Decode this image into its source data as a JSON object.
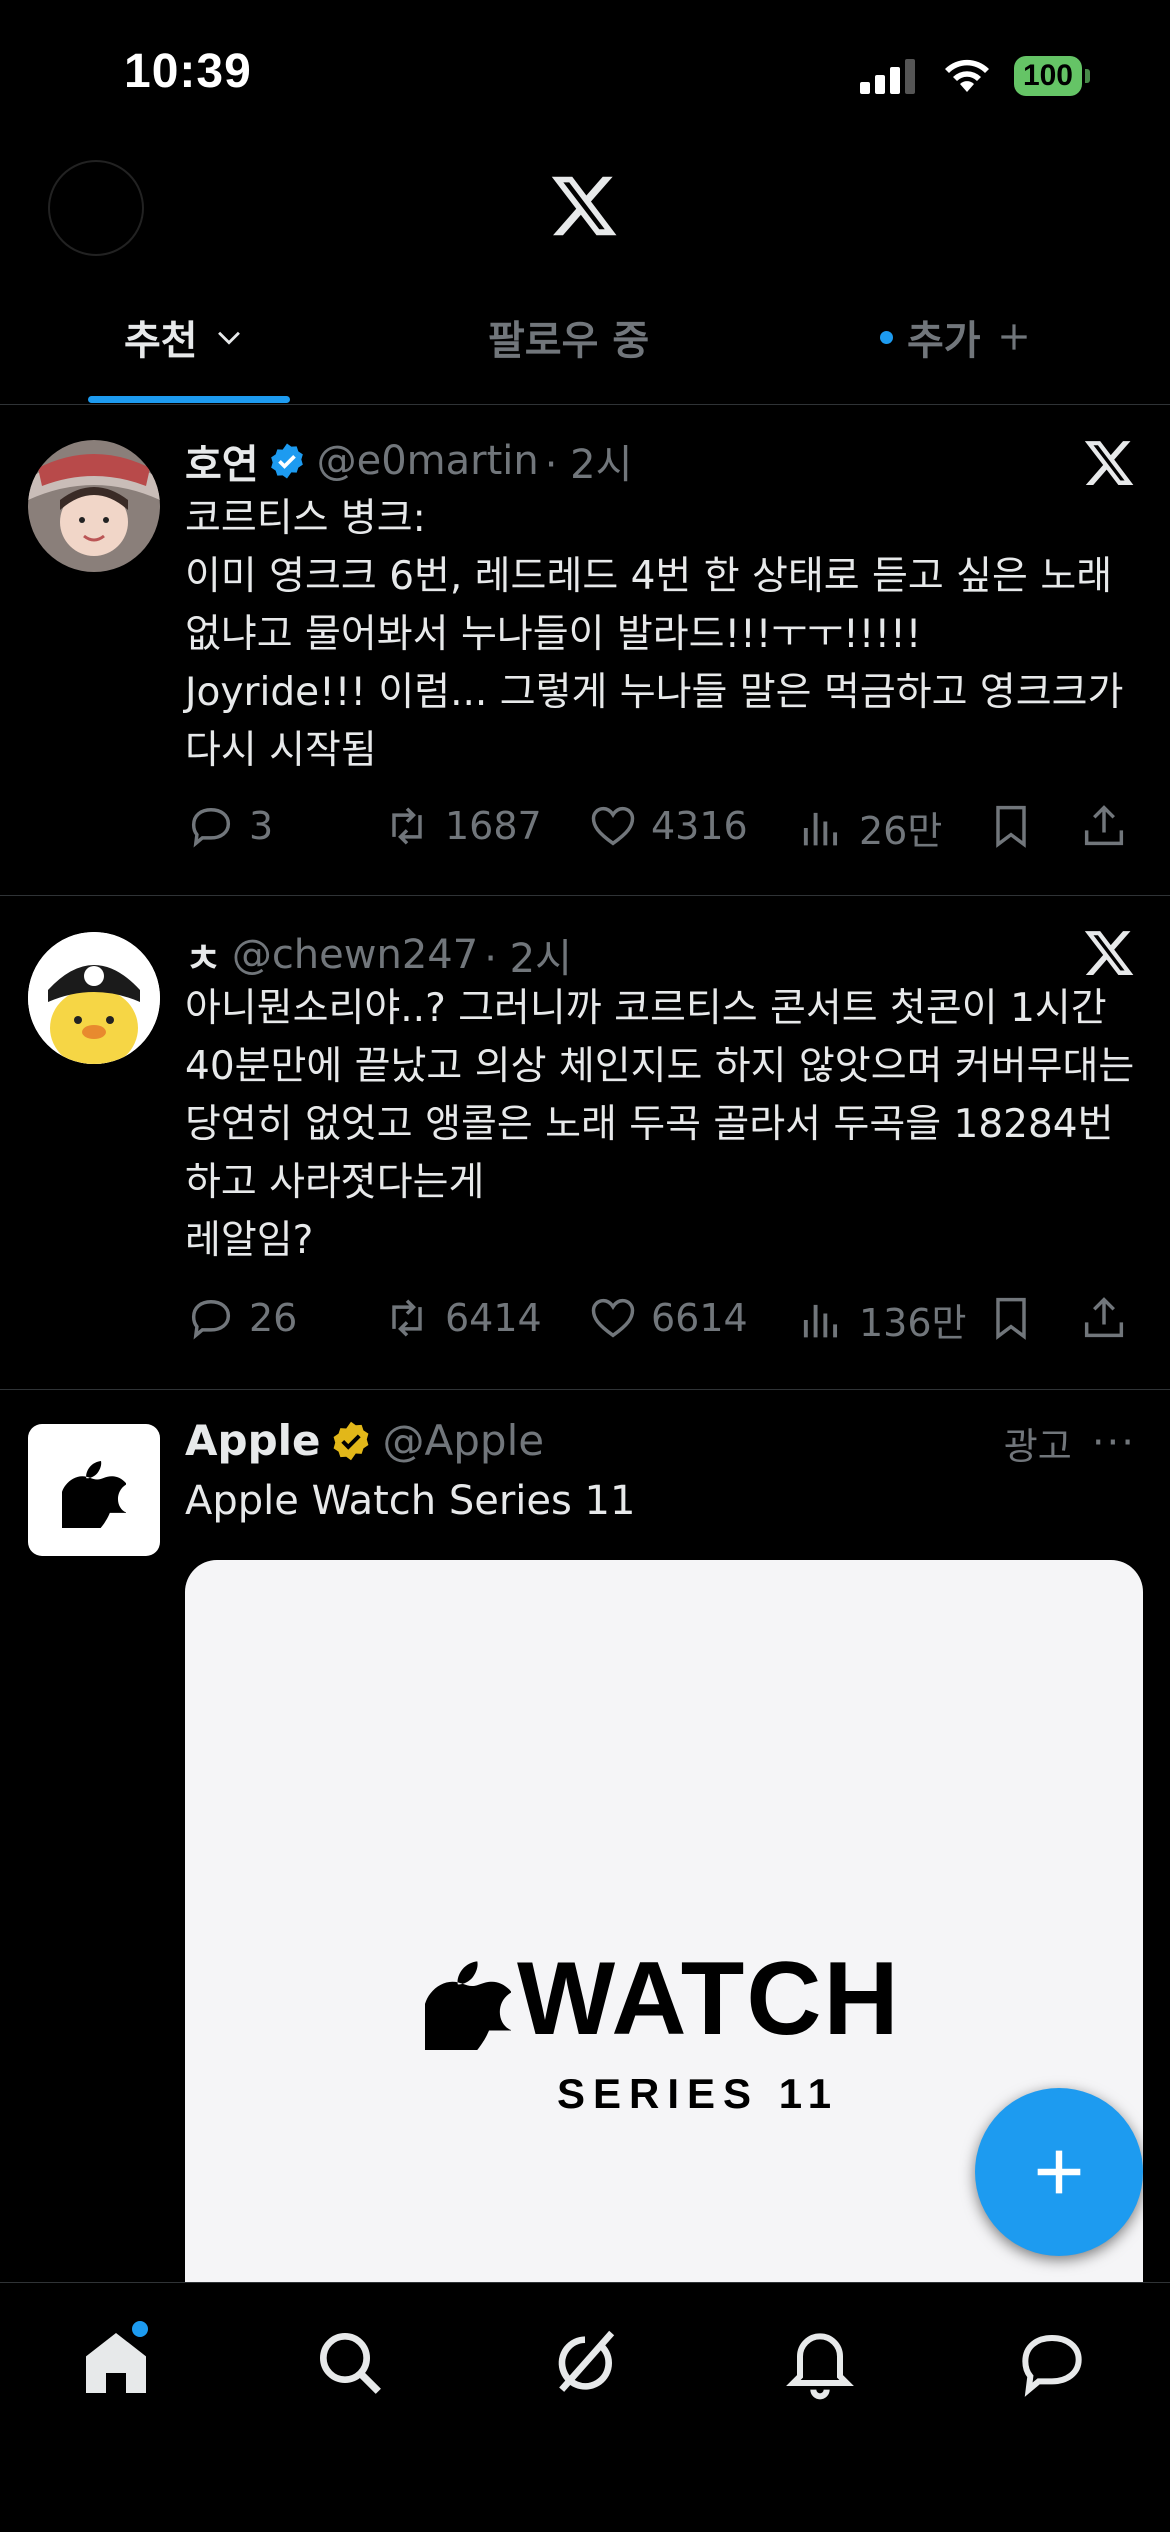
{
  "status": {
    "time": "10:39",
    "battery": "100"
  },
  "tabs": [
    {
      "label": "추천"
    },
    {
      "label": "팔로우 중"
    },
    {
      "label": "추가"
    }
  ],
  "tweets": [
    {
      "name": "호연",
      "handle": "@e0martin",
      "time": "· 2시",
      "text": "코르티스 병크:\n이미 영크크 6번, 레드레드 4번 한 상태로 듣고 싶은 노래 없냐고 물어봐서 누나들이 발라드!!!ㅜㅜ!!!!!\nJoyride!!! 이럼... 그렇게 누나들 말은 먹금하고 영크크가 다시 시작됨",
      "replies": "3",
      "reposts": "1687",
      "likes": "4316",
      "views": "26만"
    },
    {
      "name": "ㅊ",
      "handle": "@chewn247",
      "time": "· 2시",
      "text": "아니뭔소리야..? 그러니까 코르티스 콘서트 첫콘이 1시간 40분만에 끝났고 의상 체인지도 하지 않앗으며 커버무대는 당연히 없엇고 앵콜은 노래 두곡 골라서 두곡을 18284번 하고 사라졋다는게\n레알임?",
      "replies": "26",
      "reposts": "6414",
      "likes": "6614",
      "views": "136만"
    }
  ],
  "ad": {
    "name": "Apple",
    "handle": "@Apple",
    "label": "광고",
    "more": "···",
    "text": "Apple Watch Series 11",
    "card_title": "WATCH",
    "card_subtitle": "SERIES 11"
  },
  "colors": {
    "accent": "#1d9bf0",
    "muted": "#71767b",
    "gold": "#e2b719",
    "battery": "#65c466"
  }
}
